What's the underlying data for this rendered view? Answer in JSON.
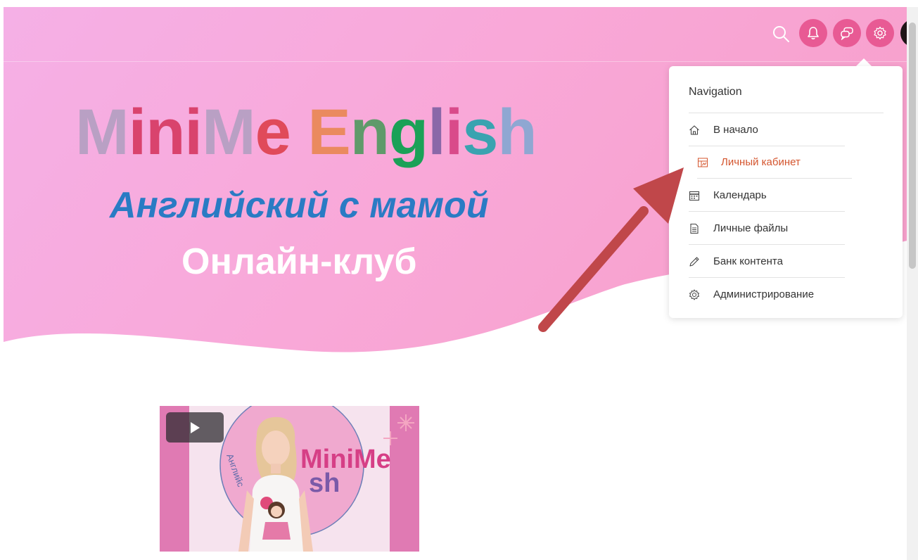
{
  "hero": {
    "brand_letters": [
      {
        "ch": "M",
        "color": "#b9a0c4"
      },
      {
        "ch": "i",
        "color": "#d9436d"
      },
      {
        "ch": "n",
        "color": "#d9436d"
      },
      {
        "ch": "i",
        "color": "#d9436d"
      },
      {
        "ch": "M",
        "color": "#b9a0c4"
      },
      {
        "ch": "e",
        "color": "#e04a5a"
      },
      {
        "ch": " ",
        "color": "#ffffff"
      },
      {
        "ch": "E",
        "color": "#ea8a5f"
      },
      {
        "ch": "n",
        "color": "#5f9a6a"
      },
      {
        "ch": "g",
        "color": "#1aa157"
      },
      {
        "ch": "l",
        "color": "#8a68a8"
      },
      {
        "ch": "i",
        "color": "#d94a8a"
      },
      {
        "ch": "s",
        "color": "#3aa3b0"
      },
      {
        "ch": "h",
        "color": "#8fa7d2"
      }
    ],
    "subtitle": "Английский с мамой",
    "club_label": "Онлайн-клуб"
  },
  "navbar": {
    "search_icon": "search-icon",
    "bell_icon": "bell-icon",
    "chat_icon": "chat-icon",
    "gear_icon": "gear-icon"
  },
  "dropdown": {
    "header": "Navigation",
    "items": [
      {
        "label": "В начало",
        "icon": "home-icon"
      },
      {
        "label": "Личный кабинет",
        "icon": "dashboard-icon",
        "active": true
      },
      {
        "label": "Календарь",
        "icon": "calendar-icon"
      },
      {
        "label": "Личные файлы",
        "icon": "file-icon"
      },
      {
        "label": "Банк контента",
        "icon": "pencil-icon"
      },
      {
        "label": "Администрирование",
        "icon": "gear-icon"
      }
    ]
  },
  "video": {
    "thumbnail_text_top": "MiniMe",
    "thumbnail_text_bottom": "sh",
    "thumbnail_side_text": "Английс"
  },
  "colors": {
    "hero_pink": "#f7a8d4",
    "accent_pink": "#e85a94",
    "active_item": "#d4552e",
    "arrow": "#c0474a"
  }
}
